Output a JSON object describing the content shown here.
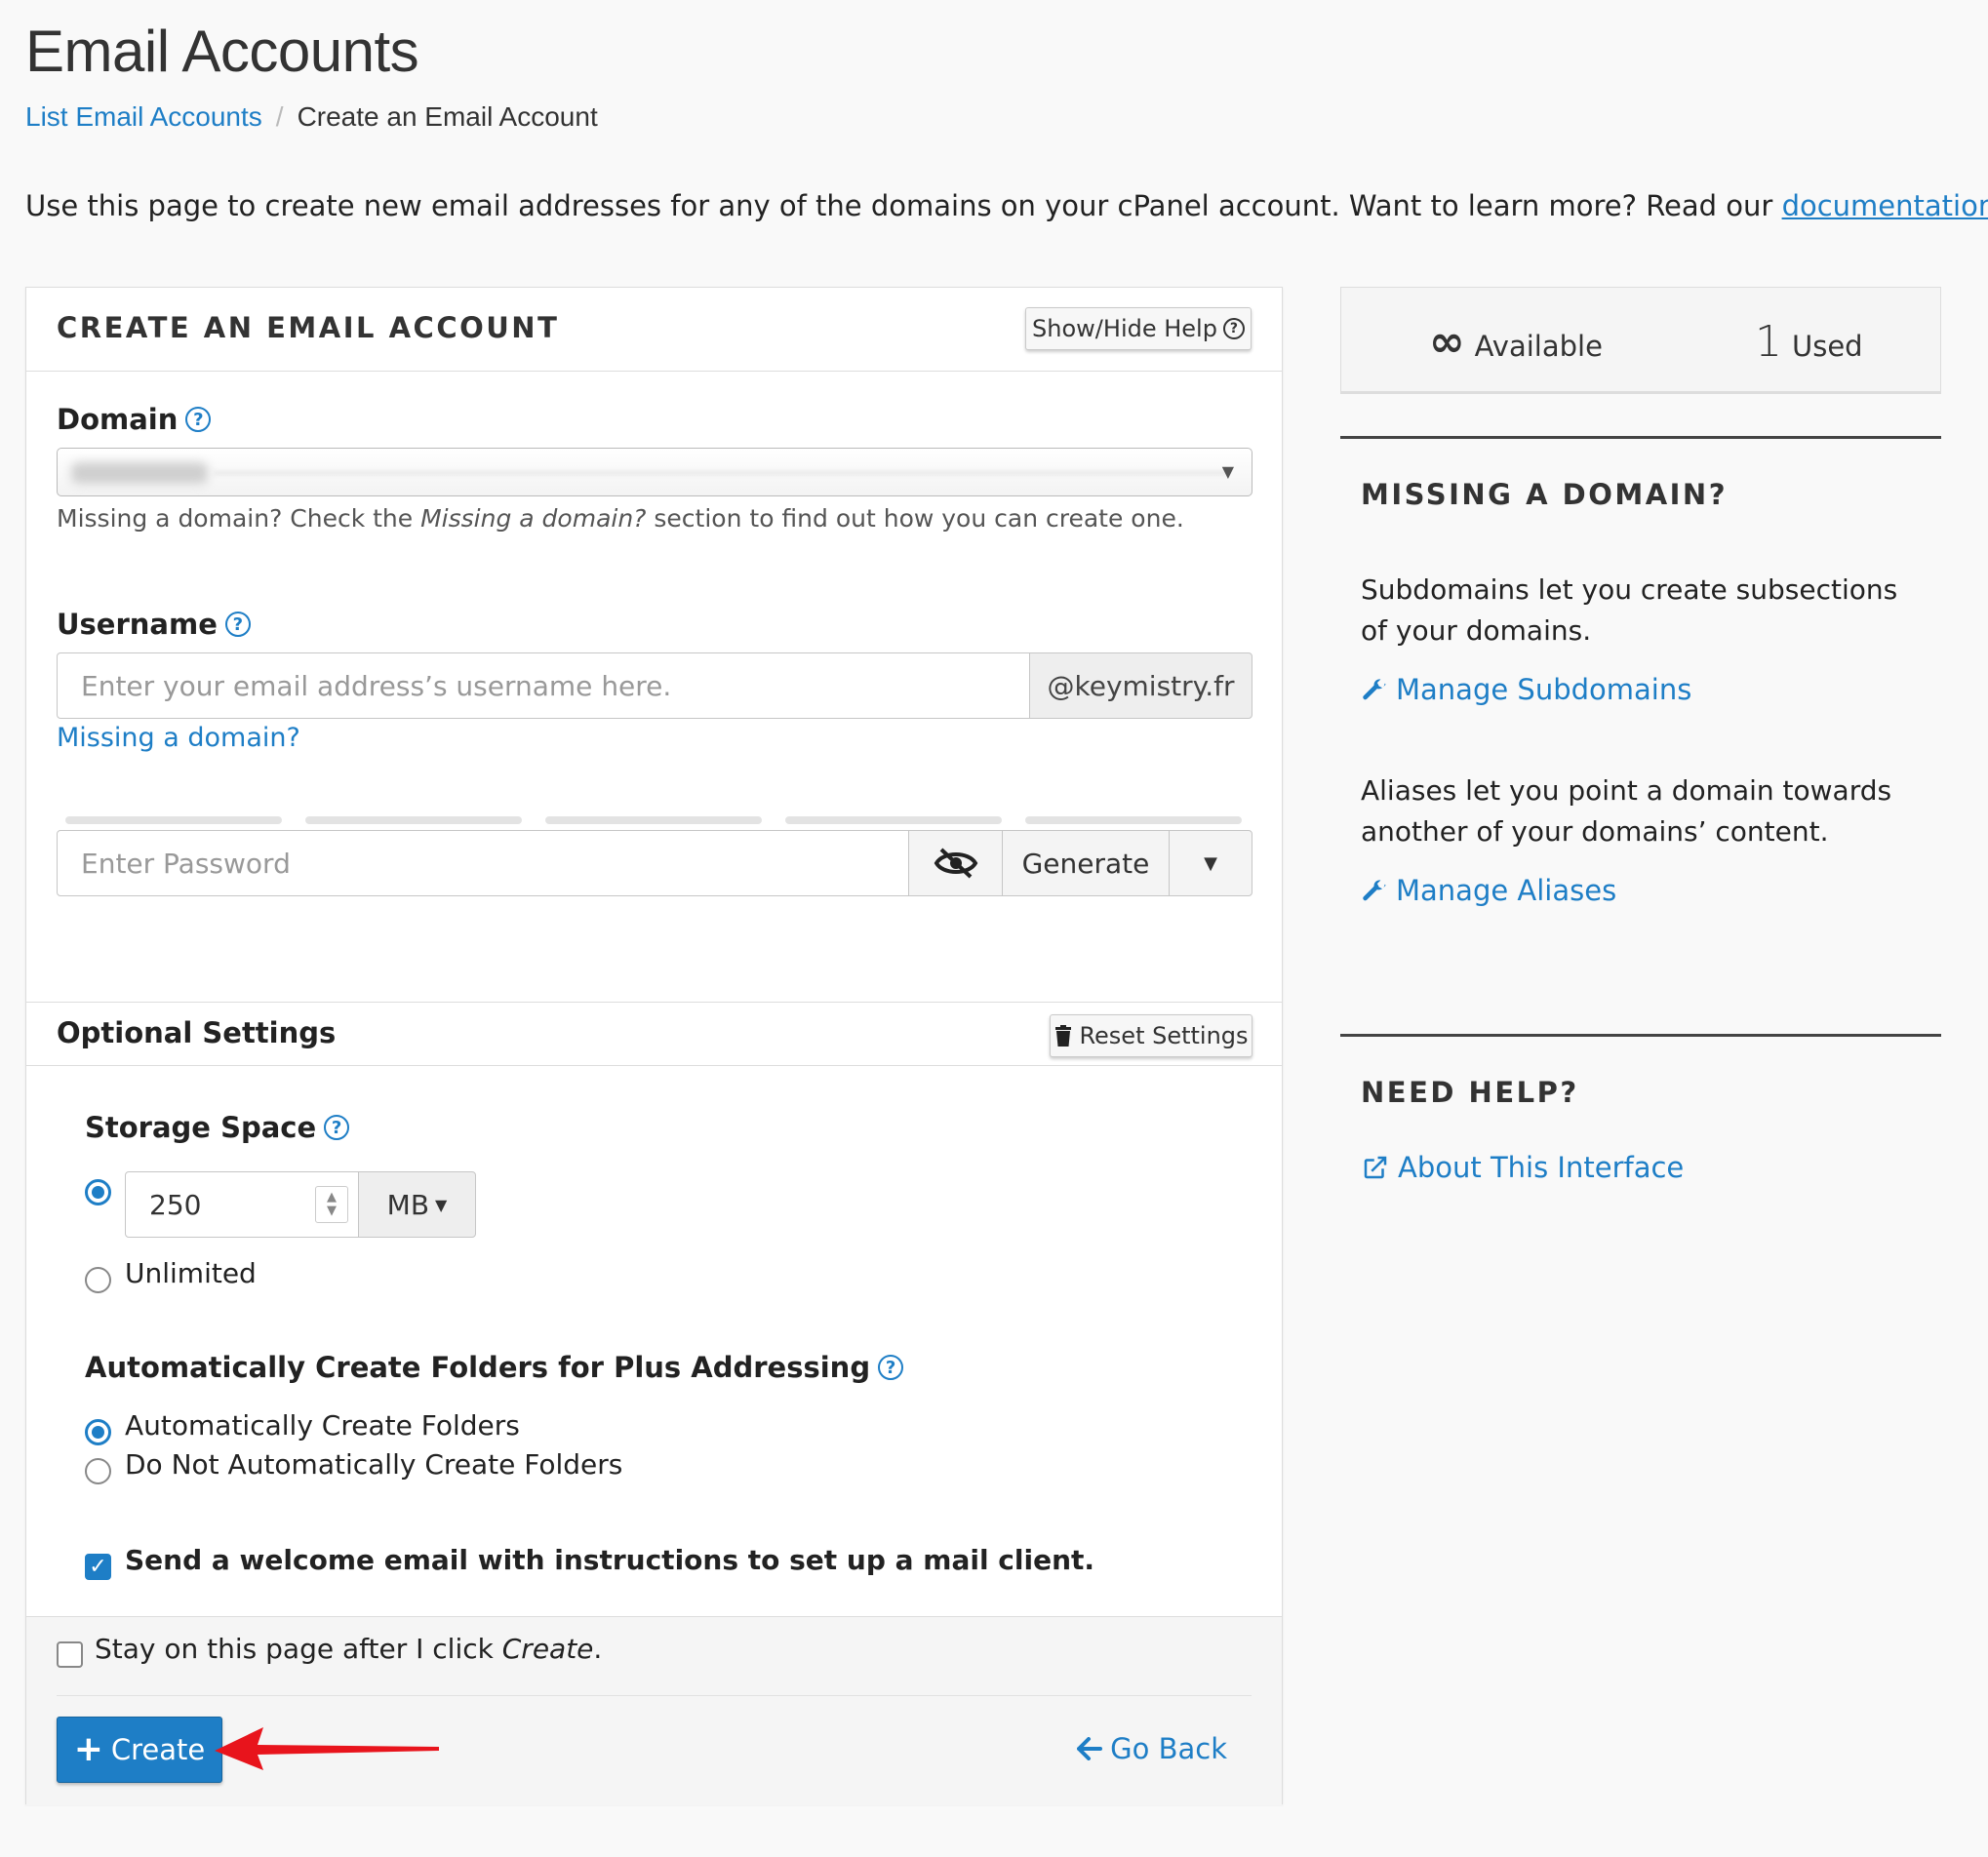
{
  "page": {
    "title": "Email Accounts",
    "breadcrumb": {
      "link": "List Email Accounts",
      "current": "Create an Email Account"
    },
    "intro_text": "Use this page to create new email addresses for any of the domains on your cPanel account. Want to learn more? Read our",
    "intro_link": "documentation",
    "intro_end": "."
  },
  "form": {
    "panel_title": "CREATE AN EMAIL ACCOUNT",
    "show_hide_help": "Show/Hide Help",
    "domain_label": "Domain",
    "domain_hint_pre": "Missing a domain? Check the ",
    "domain_hint_em": "Missing a domain?",
    "domain_hint_post": " section to find out how you can create one.",
    "username_label": "Username",
    "username_placeholder": "Enter your email address’s username here.",
    "username_suffix": "@keymistry.fr",
    "missing_domain_link": "Missing a domain?",
    "password_placeholder": "Enter Password",
    "generate_label": "Generate",
    "optional_title": "Optional Settings",
    "reset_label": "Reset Settings",
    "storage_label": "Storage Space",
    "storage_value": "250",
    "storage_unit": "MB",
    "unlimited_label": "Unlimited",
    "plus_label": "Automatically Create Folders for Plus Addressing",
    "auto_create": "Automatically Create Folders",
    "no_auto_create": "Do Not Automatically Create Folders",
    "welcome_email": "Send a welcome email with instructions to set up a mail client.",
    "stay_pre": "Stay on this page after I click ",
    "stay_em": "Create",
    "stay_post": ".",
    "create_label": "Create",
    "go_back_label": "Go Back"
  },
  "sidebar": {
    "available_symbol": "∞",
    "available_label": "Available",
    "used_count": "1",
    "used_label": "Used",
    "missing_title": "MISSING A DOMAIN?",
    "subdomains_text": "Subdomains let you create subsections of your domains.",
    "manage_subdomains": "Manage Subdomains",
    "aliases_text": "Aliases let you point a domain towards another of your domains’ content.",
    "manage_aliases": "Manage Aliases",
    "help_title": "NEED HELP?",
    "about_link": "About This Interface"
  },
  "icons": [
    "external-link-icon",
    "question-circle-icon",
    "eye-slash-icon",
    "caret-down-icon",
    "trash-icon",
    "wrench-icon",
    "plus-icon",
    "arrow-left-icon",
    "infinity-icon"
  ],
  "colors": {
    "accent": "#1e7ec6",
    "annotation_arrow": "#e8141c"
  }
}
